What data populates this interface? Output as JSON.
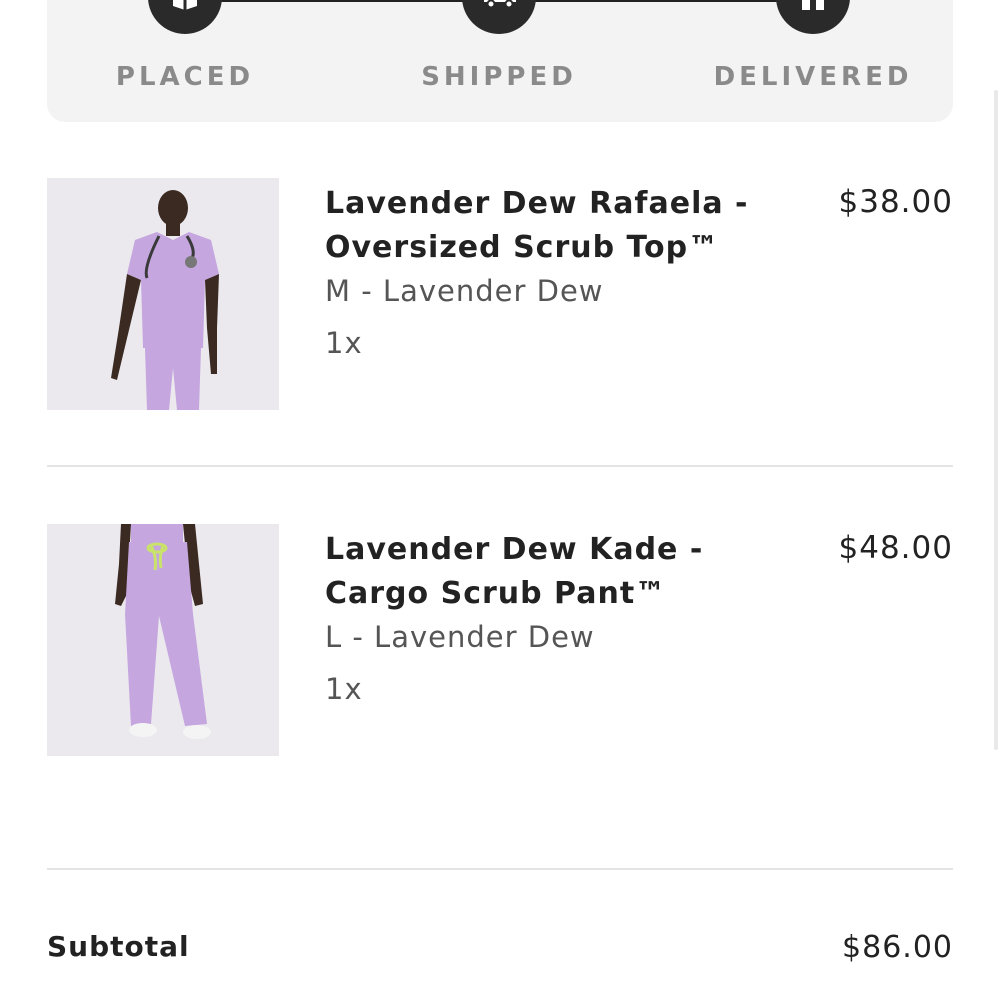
{
  "tracker": {
    "steps": [
      {
        "label": "PLACED",
        "icon": "box-icon"
      },
      {
        "label": "SHIPPED",
        "icon": "truck-icon"
      },
      {
        "label": "DELIVERED",
        "icon": "house-icon"
      }
    ]
  },
  "items": [
    {
      "name": "Lavender Dew Rafaela - Oversized Scrub Top™",
      "variant": "M - Lavender Dew",
      "quantity": "1x",
      "price": "$38.00",
      "image": "product-photo-scrub-top"
    },
    {
      "name": "Lavender Dew Kade - Cargo Scrub Pant™",
      "variant": "L - Lavender Dew",
      "quantity": "1x",
      "price": "$48.00",
      "image": "product-photo-scrub-pant"
    }
  ],
  "summary": {
    "subtotal_label": "Subtotal",
    "subtotal_value": "$86.00"
  },
  "colors": {
    "lavender": "#c7a8e0",
    "tracker_bg": "#f3f3f3",
    "step_label": "#8a8a8a"
  }
}
